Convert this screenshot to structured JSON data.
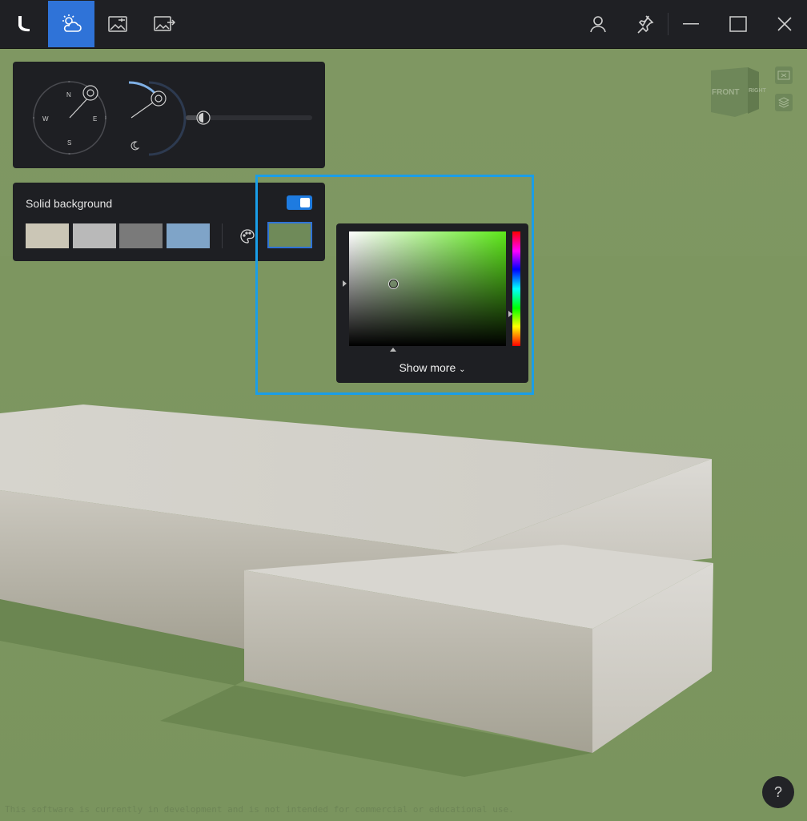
{
  "titlebar": {
    "tabs": [
      {
        "icon": "app-logo-icon"
      },
      {
        "icon": "weather-sun-cloud-icon",
        "active": true
      },
      {
        "icon": "image-settings-icon"
      },
      {
        "icon": "image-export-icon"
      }
    ],
    "right_icons": [
      "user-icon",
      "pin-icon",
      "minimize-icon",
      "maximize-icon",
      "close-icon"
    ]
  },
  "sun_panel": {
    "compass": {
      "north": "N",
      "east": "E",
      "south": "S",
      "west": "W"
    },
    "time_icon": "moon-icon",
    "slider_icon": "contrast-icon"
  },
  "background_panel": {
    "label": "Solid background",
    "toggle_on": true,
    "swatches": [
      "#cbc6b6",
      "#b9b9b9",
      "#7a7a7a",
      "#7fa4c8"
    ],
    "palette_icon": "palette-icon",
    "selected_color": "#6f8a59"
  },
  "color_picker": {
    "hue_color": "#5de91a",
    "show_more_label": "Show more"
  },
  "view_cube": {
    "front": "FRONT",
    "right": "RIGHT"
  },
  "help_label": "?",
  "footer_text": "This software is currently in development and is not intended for commercial or educational use.",
  "colors": {
    "accent": "#2f73d8",
    "highlight": "#1a9ee8",
    "viewport_bg": "#7c9662"
  }
}
